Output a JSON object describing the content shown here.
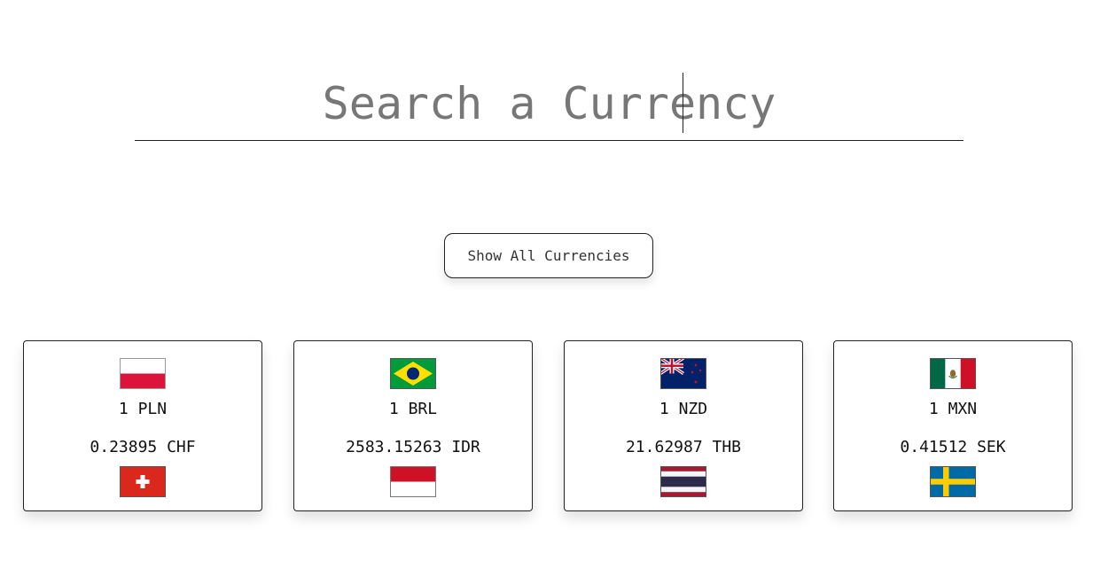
{
  "search": {
    "placeholder": "Search a Currency",
    "value": ""
  },
  "show_all_button": {
    "label": "Show All Currencies"
  },
  "cards": [
    {
      "from_label": "1 PLN",
      "to_label": "0.23895 CHF",
      "from_flag": "poland-flag-icon",
      "to_flag": "switzerland-flag-icon"
    },
    {
      "from_label": "1 BRL",
      "to_label": "2583.15263 IDR",
      "from_flag": "brazil-flag-icon",
      "to_flag": "indonesia-flag-icon"
    },
    {
      "from_label": "1 NZD",
      "to_label": "21.62987 THB",
      "from_flag": "new-zealand-flag-icon",
      "to_flag": "thailand-flag-icon"
    },
    {
      "from_label": "1 MXN",
      "to_label": "0.41512 SEK",
      "from_flag": "mexico-flag-icon",
      "to_flag": "sweden-flag-icon"
    }
  ],
  "colors": {
    "text": "#111111",
    "placeholder": "#777777",
    "border": "#222222",
    "background": "#ffffff"
  }
}
